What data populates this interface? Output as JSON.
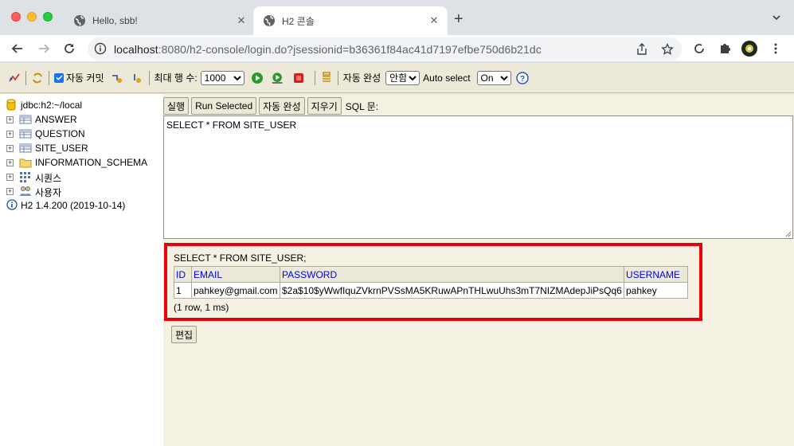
{
  "browser": {
    "tabs": [
      {
        "title": "Hello, sbb!",
        "active": false
      },
      {
        "title": "H2 콘솔",
        "active": true
      }
    ],
    "url_host": "localhost",
    "url_rest": ":8080/h2-console/login.do?jsessionid=b36361f84ac41d7197efbe750d6b21dc"
  },
  "toolbar": {
    "autocommit_label": "자동 커밋",
    "maxrows_label": "최대 행 수:",
    "maxrows_value": "1000",
    "autocomplete_label": "자동 완성",
    "autocomplete_value": "안함",
    "autoselect_label": "Auto select",
    "autoselect_value": "On"
  },
  "tree": {
    "root": "jdbc:h2:~/local",
    "items": [
      {
        "label": "ANSWER",
        "icon": "table-icon"
      },
      {
        "label": "QUESTION",
        "icon": "table-icon"
      },
      {
        "label": "SITE_USER",
        "icon": "table-icon"
      },
      {
        "label": "INFORMATION_SCHEMA",
        "icon": "folder-icon"
      },
      {
        "label": "시퀀스",
        "icon": "sequence-icon"
      },
      {
        "label": "사용자",
        "icon": "users-icon"
      }
    ],
    "version": "H2 1.4.200 (2019-10-14)"
  },
  "sql": {
    "run": "실행",
    "run_selected": "Run Selected",
    "autocomplete": "자동 완성",
    "clear": "지우기",
    "label": "SQL 문:",
    "text": "SELECT * FROM SITE_USER"
  },
  "result": {
    "query": "SELECT * FROM SITE_USER;",
    "columns": [
      "ID",
      "EMAIL",
      "PASSWORD",
      "USERNAME"
    ],
    "rows": [
      [
        "1",
        "pahkey@gmail.com",
        "$2a$10$yWwfIquZVkrnPVSsMA5KRuwAPnTHLwuUhs3mT7NIZMAdepJiPsQq6",
        "pahkey"
      ]
    ],
    "info": "(1 row, 1 ms)",
    "edit": "편집"
  },
  "colors": {
    "highlight_border": "#e8000a",
    "panel_bg": "#f4f0e2",
    "toolbar_bg": "#ece9d8",
    "header_link": "#0000ee"
  }
}
